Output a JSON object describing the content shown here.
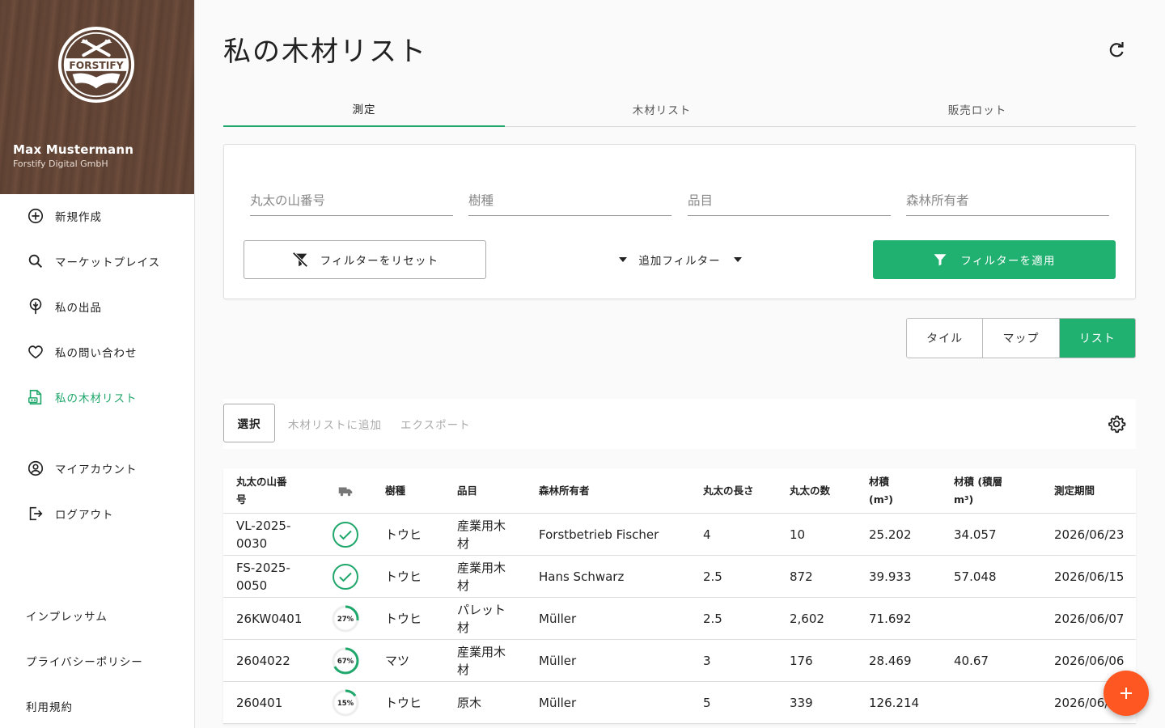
{
  "sidebar": {
    "logo_text": "FORSTIFY",
    "user_name": "Max Mustermann",
    "company": "Forstify Digital GmbH",
    "nav": [
      {
        "label": "新規作成",
        "icon": "plus-circle-icon"
      },
      {
        "label": "マーケットプレイス",
        "icon": "search-icon"
      },
      {
        "label": "私の出品",
        "icon": "tree-pin-icon"
      },
      {
        "label": "私の問い合わせ",
        "icon": "heart-icon"
      },
      {
        "label": "私の木材リスト",
        "icon": "wood-list-icon",
        "active": true
      },
      {
        "label": "マイアカウント",
        "icon": "account-icon"
      },
      {
        "label": "ログアウト",
        "icon": "logout-icon"
      }
    ],
    "footer_links": [
      "インプレッサム",
      "プライバシーポリシー",
      "利用規約"
    ]
  },
  "header": {
    "title": "私の木材リスト"
  },
  "tabs": [
    {
      "label": "測定",
      "active": true
    },
    {
      "label": "木材リスト",
      "active": false
    },
    {
      "label": "販売ロット",
      "active": false
    }
  ],
  "filters": {
    "pile_number": {
      "placeholder": "丸太の山番号",
      "value": ""
    },
    "species": {
      "placeholder": "樹種",
      "value": ""
    },
    "product": {
      "placeholder": "品目",
      "value": ""
    },
    "owner": {
      "placeholder": "森林所有者",
      "value": ""
    },
    "reset_label": "フィルターをリセット",
    "more_label": "追加フィルター",
    "apply_label": "フィルターを適用"
  },
  "view_toggle": [
    {
      "label": "タイル",
      "active": false
    },
    {
      "label": "マップ",
      "active": false
    },
    {
      "label": "リスト",
      "active": true
    }
  ],
  "actions": {
    "select_label": "選択",
    "add_to_list_label": "木材リストに追加",
    "export_label": "エクスポート"
  },
  "table": {
    "headers": {
      "pile_number": "丸太の山番号",
      "transport": "truck-icon",
      "species": "樹種",
      "product": "品目",
      "owner": "森林所有者",
      "length": "丸太の長さ",
      "count": "丸太の数",
      "volume": "材積 (m³)",
      "stacked_volume": "材積 (積層 m³)",
      "period": "測定期間"
    },
    "rows": [
      {
        "pile_number": "VL-2025-0030",
        "status": "complete",
        "progress": 100,
        "progress_label": "",
        "species": "トウヒ",
        "product": "産業用木材",
        "owner": "Forstbetrieb Fischer",
        "length": "4",
        "count": "10",
        "volume": "25.202",
        "stacked_volume": "34.057",
        "period": "2026/06/23"
      },
      {
        "pile_number": "FS-2025-0050",
        "status": "complete",
        "progress": 100,
        "progress_label": "",
        "species": "トウヒ",
        "product": "産業用木材",
        "owner": "Hans Schwarz",
        "length": "2.5",
        "count": "872",
        "volume": "39.933",
        "stacked_volume": "57.048",
        "period": "2026/06/15"
      },
      {
        "pile_number": "26KW0401",
        "status": "progress",
        "progress": 27,
        "progress_label": "27%",
        "species": "トウヒ",
        "product": "パレット材",
        "owner": "Müller",
        "length": "2.5",
        "count": "2,602",
        "volume": "71.692",
        "stacked_volume": "",
        "period": "2026/06/07"
      },
      {
        "pile_number": "2604022",
        "status": "progress",
        "progress": 67,
        "progress_label": "67%",
        "species": "マツ",
        "product": "産業用木材",
        "owner": "Müller",
        "length": "3",
        "count": "176",
        "volume": "28.469",
        "stacked_volume": "40.67",
        "period": "2026/06/06"
      },
      {
        "pile_number": "260401",
        "status": "progress",
        "progress": 15,
        "progress_label": "15%",
        "species": "トウヒ",
        "product": "原木",
        "owner": "Müller",
        "length": "5",
        "count": "339",
        "volume": "126.214",
        "stacked_volume": "",
        "period": "2026/06/"
      }
    ]
  },
  "fab": {
    "icon": "plus-icon"
  },
  "colors": {
    "accent": "#20b070",
    "fab": "#ff5722",
    "sidebar_wood": "#5e4234"
  }
}
